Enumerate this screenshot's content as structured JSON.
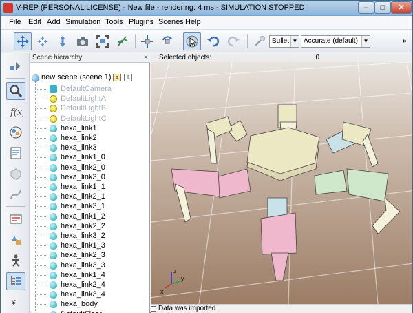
{
  "window": {
    "title": "V-REP (PERSONAL LICENSE) - New file - rendering: 4 ms - SIMULATION STOPPED",
    "minimize": "–",
    "maximize": "□",
    "close": "✕"
  },
  "menu": [
    "File",
    "Edit",
    "Add",
    "Simulation",
    "Tools",
    "Plugins",
    "Scenes",
    "Help"
  ],
  "toolbar": {
    "engine": "Bullet",
    "accuracy": "Accurate (default)",
    "more": "»",
    "icons": [
      "camera-pan-icon",
      "camera-rotate-icon",
      "camera-shift-icon",
      "camera-angle-icon",
      "fit-to-view-icon",
      "manipulate-icon",
      "translate-object-icon",
      "rotate-object-icon",
      "click-select-icon",
      "undo-icon",
      "redo-icon",
      "dynamics-toggle-icon"
    ]
  },
  "lefttools": {
    "icons": [
      "simulation-settings-icon",
      "scene-object-properties-icon",
      "calculation-modules-icon",
      "collections-icon",
      "scripts-icon",
      "shape-edit-icon",
      "path-edit-icon",
      "selection-icon",
      "model-browser-icon",
      "scene-hierarchy-icon"
    ],
    "expand": "¥"
  },
  "hierarchy": {
    "title": "Scene hierarchy",
    "close": "×",
    "root": "new scene (scene 1)",
    "root_badge_a": "a",
    "root_badge_b": "lll",
    "items": [
      {
        "label": "DefaultCamera",
        "type": "camera",
        "dim": true
      },
      {
        "label": "DefaultLightA",
        "type": "light",
        "dim": true
      },
      {
        "label": "DefaultLightB",
        "type": "light",
        "dim": true
      },
      {
        "label": "DefaultLightC",
        "type": "light",
        "dim": true
      },
      {
        "label": "hexa_link1",
        "type": "shape",
        "dim": false
      },
      {
        "label": "hexa_link2",
        "type": "shape",
        "dim": false
      },
      {
        "label": "hexa_link3",
        "type": "shape",
        "dim": false
      },
      {
        "label": "hexa_link1_0",
        "type": "shape",
        "dim": false
      },
      {
        "label": "hexa_link2_0",
        "type": "shape",
        "dim": false
      },
      {
        "label": "hexa_link3_0",
        "type": "shape",
        "dim": false
      },
      {
        "label": "hexa_link1_1",
        "type": "shape",
        "dim": false
      },
      {
        "label": "hexa_link2_1",
        "type": "shape",
        "dim": false
      },
      {
        "label": "hexa_link3_1",
        "type": "shape",
        "dim": false
      },
      {
        "label": "hexa_link1_2",
        "type": "shape",
        "dim": false
      },
      {
        "label": "hexa_link2_2",
        "type": "shape",
        "dim": false
      },
      {
        "label": "hexa_link3_2",
        "type": "shape",
        "dim": false
      },
      {
        "label": "hexa_link1_3",
        "type": "shape",
        "dim": false
      },
      {
        "label": "hexa_link2_3",
        "type": "shape",
        "dim": false
      },
      {
        "label": "hexa_link3_3",
        "type": "shape",
        "dim": false
      },
      {
        "label": "hexa_link1_4",
        "type": "shape",
        "dim": false
      },
      {
        "label": "hexa_link2_4",
        "type": "shape",
        "dim": false
      },
      {
        "label": "hexa_link3_4",
        "type": "shape",
        "dim": false
      },
      {
        "label": "hexa_body",
        "type": "shape",
        "dim": false
      },
      {
        "label": "DefaultFloor",
        "type": "floor",
        "dim": false
      }
    ]
  },
  "viewport": {
    "selected_label": "Selected objects:",
    "selected_count": "0",
    "axis_x": "x",
    "axis_y": "y",
    "axis_z": "z"
  },
  "status": {
    "text": "Data was imported."
  },
  "colors": {
    "pink": "#f0b8cc",
    "cream": "#ece8c3",
    "mint": "#cfe8cc",
    "blue": "#c9e2ea",
    "floor": "#b59a84"
  }
}
